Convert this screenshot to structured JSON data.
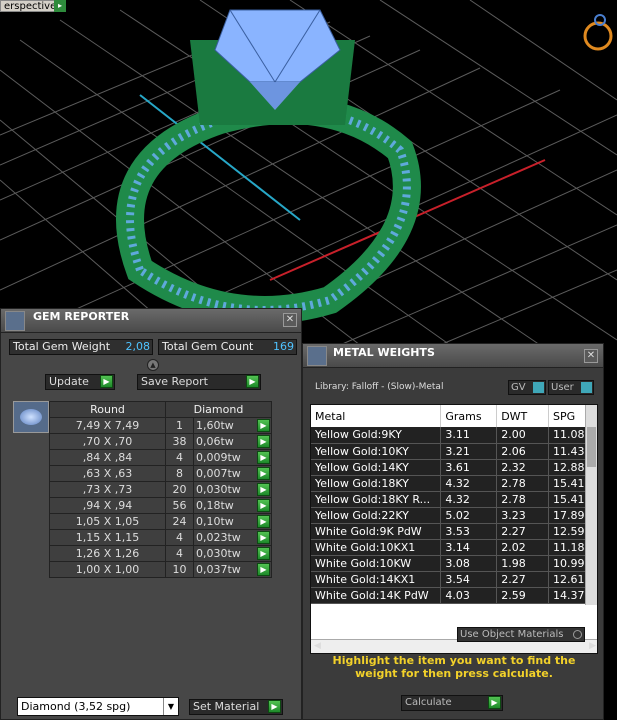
{
  "viewport": {
    "label": "erspective"
  },
  "gem_reporter": {
    "title": "GEM REPORTER",
    "total_gem_weight_label": "Total Gem Weight",
    "total_gem_weight": "2,08",
    "total_gem_count_label": "Total Gem Count",
    "total_gem_count": "169",
    "update_label": "Update",
    "save_report_label": "Save Report",
    "col_shape": "Round",
    "col_type": "Diamond",
    "rows": [
      {
        "size": "7,49 X 7,49",
        "count": "1",
        "weight": "1,60tw"
      },
      {
        "size": ",70 X ,70",
        "count": "38",
        "weight": "0,06tw"
      },
      {
        "size": ",84 X ,84",
        "count": "4",
        "weight": "0,009tw"
      },
      {
        "size": ",63 X ,63",
        "count": "8",
        "weight": "0,007tw"
      },
      {
        "size": ",73 X ,73",
        "count": "20",
        "weight": "0,030tw"
      },
      {
        "size": ",94 X ,94",
        "count": "56",
        "weight": "0,18tw"
      },
      {
        "size": "1,05 X 1,05",
        "count": "24",
        "weight": "0,10tw"
      },
      {
        "size": "1,15 X 1,15",
        "count": "4",
        "weight": "0,023tw"
      },
      {
        "size": "1,26 X 1,26",
        "count": "4",
        "weight": "0,030tw"
      },
      {
        "size": "1,00 X 1,00",
        "count": "10",
        "weight": "0,037tw"
      }
    ],
    "material_select": "Diamond     (3,52 spg)",
    "set_material_label": "Set Material"
  },
  "metal_weights": {
    "title": "METAL WEIGHTS",
    "library": "Library: Falloff - (Slow)-Metal",
    "gv_label": "GV",
    "user_label": "User",
    "columns": [
      "Metal",
      "Grams",
      "DWT",
      "SPG"
    ],
    "rows": [
      [
        "Yellow Gold:9KY",
        "3.11",
        "2.00",
        "11.08"
      ],
      [
        "Yellow Gold:10KY",
        "3.21",
        "2.06",
        "11.43"
      ],
      [
        "Yellow Gold:14KY",
        "3.61",
        "2.32",
        "12.88"
      ],
      [
        "Yellow Gold:18KY",
        "4.32",
        "2.78",
        "15.41"
      ],
      [
        "Yellow Gold:18KY R...",
        "4.32",
        "2.78",
        "15.41"
      ],
      [
        "Yellow Gold:22KY",
        "5.02",
        "3.23",
        "17.89"
      ],
      [
        "White Gold:9K PdW",
        "3.53",
        "2.27",
        "12.59"
      ],
      [
        "White Gold:10KX1",
        "3.14",
        "2.02",
        "11.18"
      ],
      [
        "White Gold:10KW",
        "3.08",
        "1.98",
        "10.99"
      ],
      [
        "White Gold:14KX1",
        "3.54",
        "2.27",
        "12.61"
      ],
      [
        "White Gold:14K PdW",
        "4.03",
        "2.59",
        "14.37"
      ]
    ],
    "use_object_materials": "Use Object Materials",
    "hint": "Highlight the item you want to find the weight for then press calculate.",
    "calculate_label": "Calculate"
  },
  "colors": {
    "ring": "#1f8a4a",
    "gem": "#8ab4ff",
    "accent_yellow": "#f2d12a",
    "grid": "#6e6e6e"
  }
}
